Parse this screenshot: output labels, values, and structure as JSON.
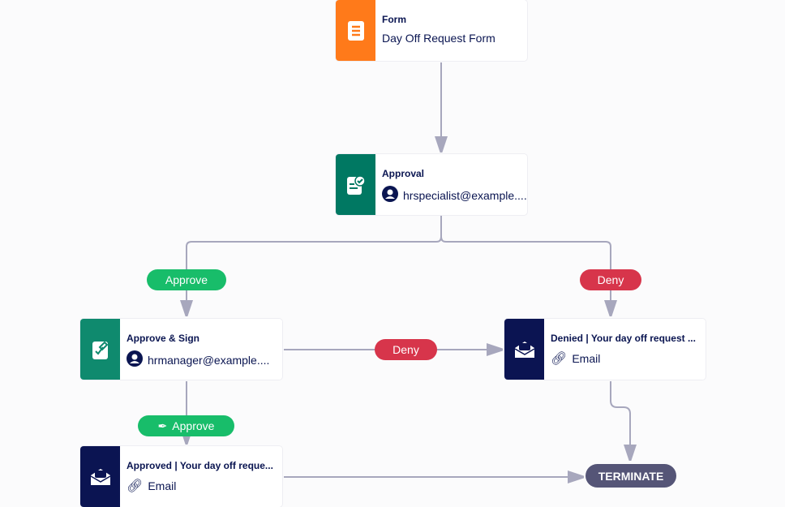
{
  "nodes": {
    "form": {
      "title": "Form",
      "subtitle": "Day Off Request Form",
      "color": "#ff7a1a",
      "icon": "form-icon"
    },
    "approval": {
      "title": "Approval",
      "subtitle": "hrspecialist@example....",
      "color": "#007862",
      "icon": "approval-icon"
    },
    "approve_sign": {
      "title": "Approve & Sign",
      "subtitle": "hrmanager@example....",
      "color": "#0f8a6e",
      "icon": "sign-icon"
    },
    "denied": {
      "title": "Denied | Your day off request ...",
      "subtitle": "Email",
      "color": "#0b1452",
      "icon": "email-icon"
    },
    "approved": {
      "title": "Approved | Your day off reque...",
      "subtitle": "Email",
      "color": "#0b1452",
      "icon": "email-icon"
    }
  },
  "edges": {
    "approve1": "Approve",
    "deny1": "Deny",
    "deny2": "Deny",
    "approve2": "Approve"
  },
  "terminate": "TERMINATE",
  "colors": {
    "approve": "#18bd6a",
    "deny": "#d7354b",
    "line": "#a7a7bd",
    "terminate": "#555577"
  }
}
